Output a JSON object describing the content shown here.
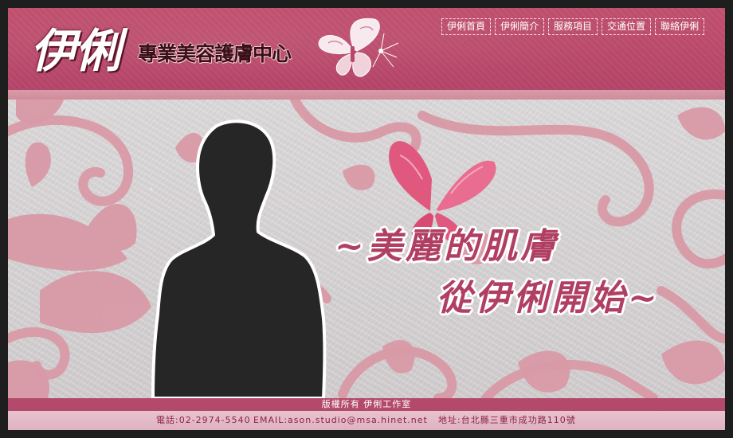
{
  "header": {
    "logo_main": "伊俐",
    "logo_sub": "專業美容護膚中心",
    "logo_icon": "butterfly-icon"
  },
  "nav": {
    "items": [
      "伊俐首頁",
      "伊俐簡介",
      "服務項目",
      "交通位置",
      "聯絡伊俐"
    ]
  },
  "banner": {
    "tagline_line1": "~美麗的肌膚",
    "tagline_line2": "從伊俐開始~",
    "icons": [
      "butterfly-icon",
      "woman-silhouette",
      "floral-swirl-pattern"
    ]
  },
  "footer": {
    "copyright": "版權所有 伊俐工作室",
    "phone": "電話:02-2974-5540",
    "email": "EMAIL:ason.studio@msa.hinet.net",
    "address": "地址:台北縣三重市成功路110號"
  },
  "colors": {
    "header": "#b9476c",
    "accent": "#b03f63",
    "footer_bar": "#b34a6b",
    "footer_band": "#e3b8c6",
    "banner_bg": "#d6d3d4",
    "floral": "#d99aa7"
  }
}
